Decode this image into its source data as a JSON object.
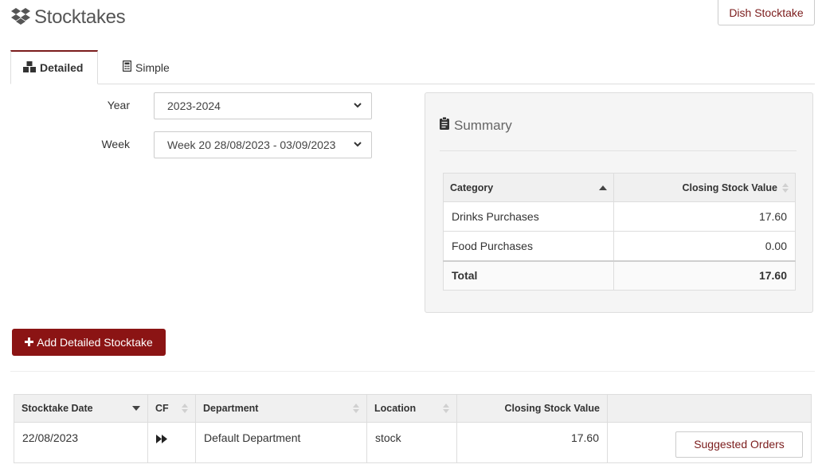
{
  "header": {
    "title": "Stocktakes",
    "title_icon": "dropbox-icon",
    "dish_button": "Dish Stocktake"
  },
  "tabs": [
    {
      "label": "Detailed",
      "icon": "cubes-icon",
      "active": true
    },
    {
      "label": "Simple",
      "icon": "calculator-icon",
      "active": false
    }
  ],
  "filters": {
    "year_label": "Year",
    "year_value": "2023-2024",
    "week_label": "Week",
    "week_value": "Week 20 28/08/2023 - 03/09/2023"
  },
  "summary": {
    "title": "Summary",
    "title_icon": "clipboard-icon",
    "columns": [
      "Category",
      "Closing Stock Value"
    ],
    "rows": [
      {
        "category": "Drinks Purchases",
        "value": "17.60"
      },
      {
        "category": "Food Purchases",
        "value": "0.00"
      }
    ],
    "total": {
      "label": "Total",
      "value": "17.60"
    }
  },
  "add_button": {
    "label": "Add Detailed Stocktake",
    "icon": "plus-icon"
  },
  "stocktakes": {
    "columns": [
      "Stocktake Date",
      "CF",
      "Department",
      "Location",
      "Closing Stock Value",
      ""
    ],
    "rows": [
      {
        "date": "22/08/2023",
        "cf_icon": "fast-forward-icon",
        "department": "Default Department",
        "location": "stock",
        "closing_value": "17.60",
        "action": "Suggested Orders"
      }
    ]
  },
  "colors": {
    "accent": "#7b1c1c",
    "primary_button": "#8b1414",
    "header_bg": "#f0f0f0",
    "panel_bg": "#f5f5f5"
  }
}
